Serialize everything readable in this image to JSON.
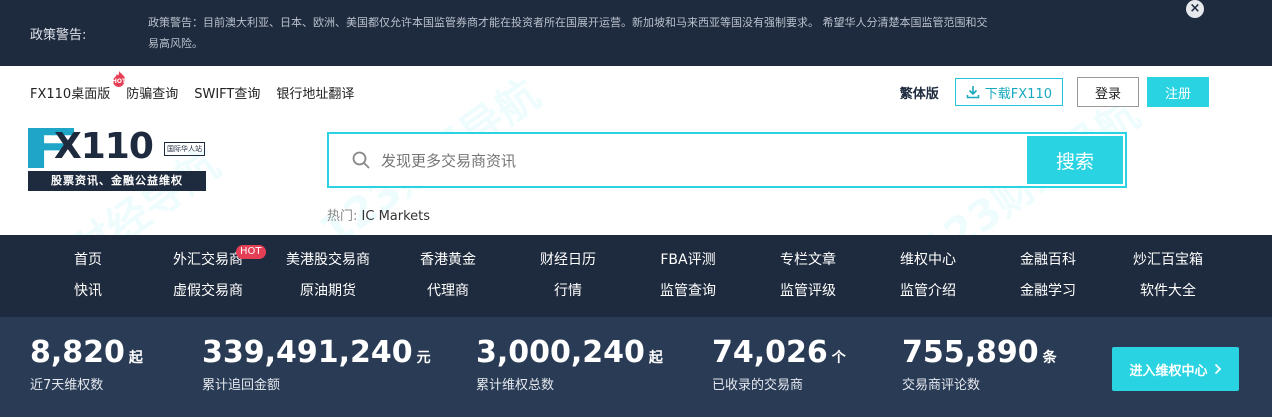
{
  "policy": {
    "label": "政策警告:",
    "text": "政策警告：目前澳大利亚、日本、欧洲、美国都仅允许本国监管券商才能在投资者所在国展开运营。新加坡和马来西亚等国没有强制要求。 希望华人分清楚本国监管范围和交易高风险。",
    "close": "×"
  },
  "topnav": {
    "links": [
      "FX110桌面版",
      "防骗查询",
      "SWIFT查询",
      "银行地址翻译"
    ],
    "traditional": "繁体版",
    "download": "下载FX110",
    "login": "登录",
    "register": "注册"
  },
  "logo": {
    "main": "X110",
    "badge": "国际华人站",
    "slogan": "股票资讯、金融公益维权"
  },
  "search": {
    "placeholder": "发现更多交易商资讯",
    "button": "搜索",
    "hot_label": "热门:",
    "hot_item": "IC Markets"
  },
  "mainnav": {
    "row1": [
      "首页",
      "外汇交易商",
      "美港股交易商",
      "香港黄金",
      "财经日历",
      "FBA评测",
      "专栏文章",
      "维权中心",
      "金融百科",
      "炒汇百宝箱"
    ],
    "row2": [
      "快讯",
      "虚假交易商",
      "原油期货",
      "代理商",
      "行情",
      "监管查询",
      "监管评级",
      "监管介绍",
      "金融学习",
      "软件大全"
    ],
    "hot_tag": "HOT"
  },
  "stats": {
    "items": [
      {
        "num": "8,820",
        "unit": "起",
        "label": "近7天维权数"
      },
      {
        "num": "339,491,240",
        "unit": "元",
        "label": "累计追回金额"
      },
      {
        "num": "3,000,240",
        "unit": "起",
        "label": "累计维权总数"
      },
      {
        "num": "74,026",
        "unit": "个",
        "label": "已收录的交易商"
      },
      {
        "num": "755,890",
        "unit": "条",
        "label": "交易商评论数"
      }
    ],
    "button": "进入维权中心"
  },
  "watermark": "123财经导航",
  "colors": {
    "navy": "#1e2a3d",
    "accent": "#2ad3e2",
    "hot": "#e53f55"
  }
}
